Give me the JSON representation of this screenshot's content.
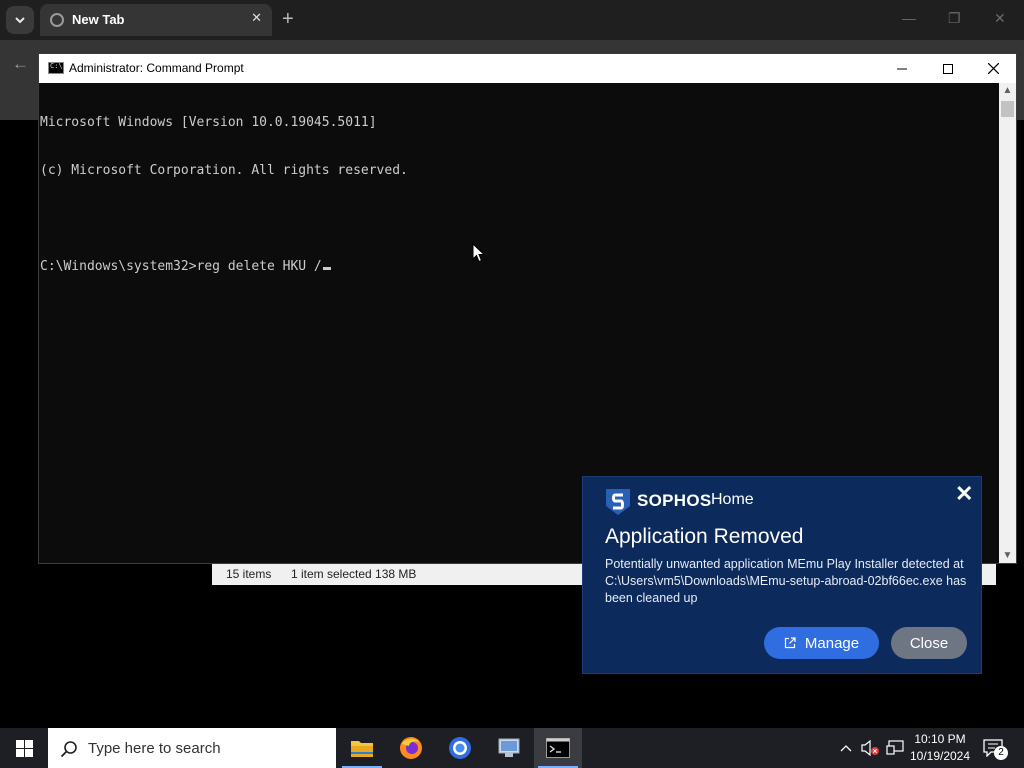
{
  "browser": {
    "tab_title": "New Tab",
    "tab_close": "✕",
    "new_tab": "+",
    "minimize": "—",
    "restore": "❐",
    "close": "✕"
  },
  "explorer_status": {
    "items_count": "15 items",
    "selection": "1 item selected  138 MB"
  },
  "cmd": {
    "title": "Administrator: Command Prompt",
    "lines": [
      "Microsoft Windows [Version 10.0.19045.5011]",
      "(c) Microsoft Corporation. All rights reserved.",
      "",
      "C:\\Windows\\system32>reg delete HKU /"
    ]
  },
  "toast": {
    "brand": "SOPHOS",
    "product": "Home",
    "title": "Application Removed",
    "message": "Potentially unwanted application MEmu Play Installer detected at C:\\Users\\vm5\\Downloads\\MEmu-setup-abroad-02bf66ec.exe has been cleaned up",
    "manage_label": "Manage",
    "close_label": "Close",
    "accent_color": "#2f6de0",
    "background_color": "#0c2a5c"
  },
  "taskbar": {
    "search_placeholder": "Type here to search",
    "apps": [
      "file-explorer",
      "firefox",
      "chrome",
      "control-panel",
      "command-prompt"
    ],
    "time": "10:10 PM",
    "date": "10/19/2024",
    "notification_count": "2"
  }
}
